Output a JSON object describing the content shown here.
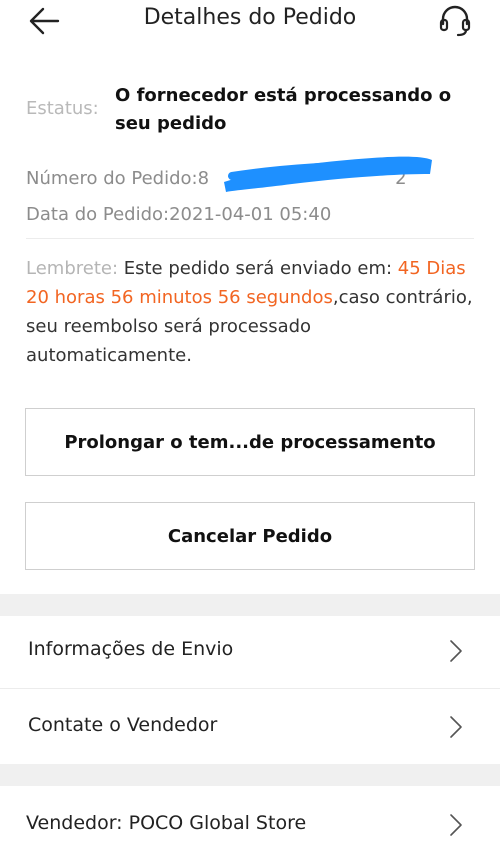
{
  "header": {
    "title": "Detalhes do Pedido",
    "back_icon": "arrow-left-icon",
    "support_icon": "headset-icon"
  },
  "status": {
    "label": "Estatus:",
    "value": "O fornecedor está processando o seu pedido"
  },
  "order": {
    "number_label": "Número do Pedido:",
    "number_value_visible_start": "8",
    "number_value_visible_end": "2",
    "date_label": "Data do Pedido:",
    "date_value": "2021-04-01 05:40"
  },
  "reminder": {
    "label": "Lembrete:",
    "text_before": " Este pedido será enviado em: ",
    "countdown": "45 Dias 20 horas 56 minutos 56 segundos",
    "text_after": ",caso contrário, seu reembolso será processado automaticamente."
  },
  "buttons": {
    "extend_label": "Prolongar o tem...de processamento",
    "cancel_label": "Cancelar Pedido"
  },
  "menu": {
    "shipping_info": "Informações de Envio",
    "contact_seller": "Contate o Vendedor",
    "seller": "Vendedor: POCO Global Store"
  },
  "colors": {
    "accent_orange": "#f26522",
    "muted_label": "#b5b5b5",
    "redaction_blue": "#1e90ff"
  }
}
